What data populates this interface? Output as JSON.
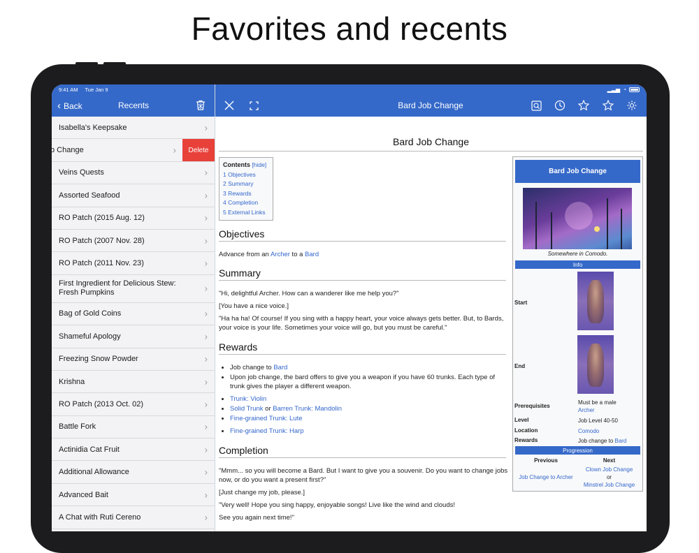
{
  "headline": "Favorites and recents",
  "status_bar": {
    "time": "9:41 AM",
    "date": "Tue Jan 9"
  },
  "sidebar": {
    "back_label": "Back",
    "title": "Recents",
    "delete_label": "Delete",
    "items": [
      {
        "label": "Isabella's Keepsake"
      },
      {
        "label": "b Change"
      },
      {
        "label": "Veins Quests"
      },
      {
        "label": "Assorted Seafood"
      },
      {
        "label": "RO Patch (2015 Aug. 12)"
      },
      {
        "label": "RO Patch (2007 Nov. 28)"
      },
      {
        "label": "RO Patch (2011 Nov. 23)"
      },
      {
        "label": "First Ingredient for Delicious Stew: Fresh Pumpkins"
      },
      {
        "label": "Bag of Gold Coins"
      },
      {
        "label": "Shameful Apology"
      },
      {
        "label": "Freezing Snow Powder"
      },
      {
        "label": "Krishna"
      },
      {
        "label": "RO Patch (2013 Oct. 02)"
      },
      {
        "label": "Battle Fork"
      },
      {
        "label": "Actinidia Cat Fruit"
      },
      {
        "label": "Additional Allowance"
      },
      {
        "label": "Advanced Bait"
      },
      {
        "label": "A Chat with Ruti Cereno"
      }
    ]
  },
  "toolbar": {
    "page_title": "Bard Job Change"
  },
  "article": {
    "title": "Bard Job Change",
    "toc": {
      "heading": "Contents",
      "hide": "[hide]",
      "items": [
        "1  Objectives",
        "2  Summary",
        "3  Rewards",
        "4  Completion",
        "5  External Links"
      ]
    },
    "objectives": {
      "heading": "Objectives",
      "pre": "Advance from an ",
      "link1": "Archer",
      "mid": " to a ",
      "link2": "Bard"
    },
    "summary": {
      "heading": "Summary",
      "p1": "\"Hi, delightful Archer. How can a wanderer like me help you?\"",
      "p2": "[You have a nice voice.]",
      "p3": "\"Ha ha ha! Of course! If you sing with a happy heart, your voice always gets better. But, to Bards, your voice is your life. Sometimes your voice will go, but you must be careful.\""
    },
    "rewards": {
      "heading": "Rewards",
      "b1_pre": "Job change to ",
      "b1_link": "Bard",
      "b2": "Upon job change, the bard offers to give you a weapon if you have 60 trunks. Each type of trunk gives the player a different weapon.",
      "w1": "Trunk: Violin",
      "w2a": "Solid Trunk",
      "w2or": " or ",
      "w2b": "Barren Trunk",
      "w2c": ": Mandolin",
      "w3": "Fine-grained Trunk: Lute",
      "w4": "Fine-grained Trunk: Harp"
    },
    "completion": {
      "heading": "Completion",
      "p1": "\"Mmm... so you will become a Bard. But I want to give you a souvenir. Do you want to change jobs now, or do you want a present first?\"",
      "p2": "[Just change my job, please.]",
      "p3": "\"Very well! Hope you sing happy, enjoyable songs! Live like the wind and clouds!",
      "p4": "See you again next time!\""
    }
  },
  "infobox": {
    "title": "Bard Job Change",
    "caption": "Somewhere in Comodo.",
    "info_header": "Info",
    "start_label": "Start",
    "end_label": "End",
    "prereq_label": "Prerequisites",
    "prereq_text": "Must be a male",
    "prereq_link": "Archer",
    "level_label": "Level",
    "level_value": "Job Level 40-50",
    "location_label": "Location",
    "location_value": "Comodo",
    "rewards_label": "Rewards",
    "rewards_pre": "Job change to ",
    "rewards_link": "Bard",
    "progression_header": "Progression",
    "previous_label": "Previous",
    "next_label": "Next",
    "previous_link": "Job Change to Archer",
    "next_link1": "Clown Job Change",
    "next_or": "or",
    "next_link2": "Minstrel Job Change"
  }
}
